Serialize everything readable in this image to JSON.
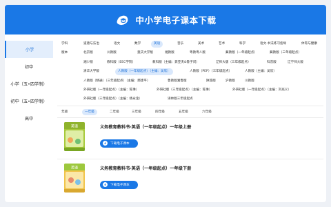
{
  "header": {
    "title": "中小学电子课本下载",
    "logo_icon": "graduate-cap-icon"
  },
  "sidebar": {
    "items": [
      {
        "label": "小学",
        "active": true
      },
      {
        "label": "初中",
        "active": false
      },
      {
        "label": "小学（五•四学制）",
        "active": false
      },
      {
        "label": "初中（五•四学制）",
        "active": false
      },
      {
        "label": "高中",
        "active": false
      }
    ]
  },
  "subjects": [
    "语文",
    "数学",
    "英语",
    "道德与法治",
    "科学",
    "音乐",
    "美术",
    "体育与健康",
    "书法练习指导",
    "劳动",
    "信息科技"
  ],
  "filters": {
    "subjects_row": [
      {
        "label": "学科",
        "active": false
      },
      {
        "label": "道德与法治",
        "active": false
      },
      {
        "label": "语文",
        "active": false
      },
      {
        "label": "数学",
        "active": false
      },
      {
        "label": "英语",
        "active": true
      },
      {
        "label": "音乐",
        "active": false
      },
      {
        "label": "美术",
        "active": false
      },
      {
        "label": "艺术",
        "active": false
      },
      {
        "label": "科学",
        "active": false
      },
      {
        "label": "语文·书法练习指导",
        "active": false
      },
      {
        "label": "体育与健康",
        "active": false
      }
    ],
    "version_rows": [
      [
        {
          "label": "版本",
          "active": false
        },
        {
          "label": "北京版",
          "active": false
        },
        {
          "label": "川教版",
          "active": false
        },
        {
          "label": "重庆大学版",
          "active": false
        },
        {
          "label": "湘教版",
          "active": false
        },
        {
          "label": "粤教粤人版",
          "active": false
        },
        {
          "label": "冀教版（一年级起点）",
          "active": false
        },
        {
          "label": "冀教版（三年级起点）",
          "active": false
        }
      ],
      [
        {
          "label": "湘少版",
          "active": false
        },
        {
          "label": "教科版（EEC学院）",
          "active": false
        },
        {
          "label": "教科版（主编：龚亚夫&鲁子问）",
          "active": false
        },
        {
          "label": "辽师大版（三年级起点）",
          "active": false
        },
        {
          "label": "科普版",
          "active": false
        },
        {
          "label": "辽宁师大版",
          "active": false
        }
      ],
      [
        {
          "label": "清华大学版",
          "active": false
        },
        {
          "label": "人教版（一年级起点）（主编：吴欣）",
          "active": true
        },
        {
          "label": "人教版（PEP）（三年级起点）",
          "active": false
        },
        {
          "label": "人教版（主编：吴欣）",
          "active": false
        }
      ],
      [
        {
          "label": "人教版（精通）（三年级起点）（主编：郝建平）",
          "active": false
        },
        {
          "label": "鲁教版湘鲁版",
          "active": false
        },
        {
          "label": "陕旅版",
          "active": false
        },
        {
          "label": "沪教版",
          "active": false
        },
        {
          "label": "川教版",
          "active": false
        }
      ],
      [
        {
          "label": "外研社版（一年级起点）（主编：陈琳）",
          "active": false
        },
        {
          "label": "外研社版（三年级起点）（主编：陈琳）",
          "active": false
        },
        {
          "label": "外研社版（一年级起点）（主编：刘兆义）",
          "active": false
        }
      ],
      [
        {
          "label": "外研社版（三年级起点）（主编：杨永淦）",
          "active": false
        },
        {
          "label": "译林版三年级起点",
          "active": false
        }
      ]
    ],
    "grades_row": [
      {
        "label": "年级",
        "active": false
      },
      {
        "label": "一年级",
        "active": true
      },
      {
        "label": "二年级",
        "active": false
      },
      {
        "label": "三年级",
        "active": false
      },
      {
        "label": "四年级",
        "active": false
      },
      {
        "label": "五年级",
        "active": false
      },
      {
        "label": "六年级",
        "active": false
      }
    ]
  },
  "books": [
    {
      "title": "义务教育教科书·英语（一年级起点）一年级上册",
      "button": "下载电子课本",
      "download_icon": "download-arrow-icon",
      "cover_label": "英语",
      "cover_color": "#a7c93b"
    },
    {
      "title": "义务教育教科书·英语（一年级起点）一年级下册",
      "button": "下载电子课本",
      "download_icon": "download-arrow-icon",
      "cover_label": "英语",
      "cover_color": "#f0c44a"
    }
  ],
  "colors": {
    "brand": "#1a78e6",
    "active_tag_bg": "#d9e8fc",
    "page_bg": "#eef1f6"
  }
}
